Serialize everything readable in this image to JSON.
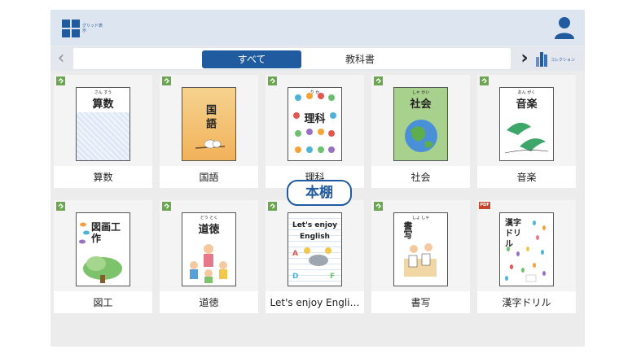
{
  "topbar": {
    "grid_label": "グリッド表示",
    "user_icon": "user-icon"
  },
  "tabs": {
    "all_label": "すべて",
    "textbook_label": "教科書",
    "collection_label": "コレクション",
    "prev_icon": "chevron-left-icon",
    "next_icon": "chevron-right-icon"
  },
  "shelf_label": "本棚",
  "books": [
    {
      "title": "算数",
      "cover_title": "算数",
      "ruby": "さん すう",
      "badge": "epub"
    },
    {
      "title": "国語",
      "cover_title": "国語",
      "ruby": "",
      "badge": "epub"
    },
    {
      "title": "理科",
      "cover_title": "理科",
      "ruby": "り か",
      "badge": "epub"
    },
    {
      "title": "社会",
      "cover_title": "社会",
      "ruby": "しゃ かい",
      "badge": "epub"
    },
    {
      "title": "音楽",
      "cover_title": "音楽",
      "ruby": "おん がく",
      "badge": "epub"
    },
    {
      "title": "図工",
      "cover_title": "図画工作",
      "ruby": "ず が こう さく",
      "badge": "epub"
    },
    {
      "title": "道徳",
      "cover_title": "道徳",
      "ruby": "どう とく",
      "badge": "epub"
    },
    {
      "title": "Let's enjoy Engli…",
      "cover_title": "Let's enjoy English",
      "ruby": "",
      "badge": "epub"
    },
    {
      "title": "書写",
      "cover_title": "書写",
      "ruby": "しょ しゃ",
      "badge": "epub"
    },
    {
      "title": "漢字ドリル",
      "cover_title": "漢字ドリル",
      "ruby": "",
      "badge": "PDF"
    }
  ],
  "colors": {
    "accent": "#1f5b9e",
    "badge_green": "#6aa84f",
    "pdf_red": "#c8442c"
  }
}
